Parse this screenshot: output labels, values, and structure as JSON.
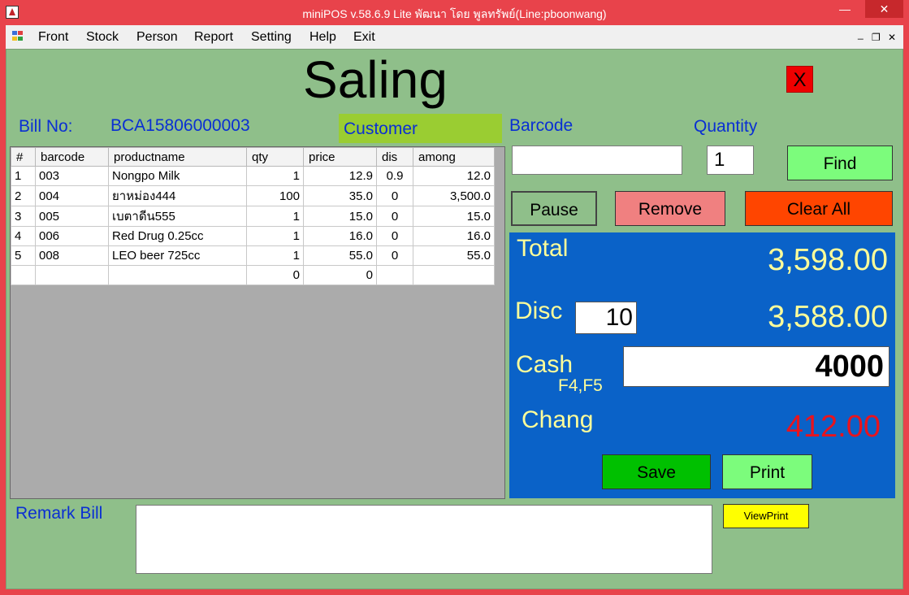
{
  "window": {
    "title": "miniPOS v.58.6.9 Lite  พัฒนา โดย พูลทรัพย์(Line:pboonwang)",
    "min_glyph": "—",
    "max_glyph": "❐",
    "close_glyph": "✕"
  },
  "menu": {
    "items": [
      "Front",
      "Stock",
      "Person",
      "Report",
      "Setting",
      "Help",
      "Exit"
    ],
    "mdi_min": "_",
    "mdi_restore": "❐",
    "mdi_close": "✕"
  },
  "form": {
    "title": "Saling",
    "close_label": "X",
    "bill_label": "Bill No:",
    "bill_value": "BCA15806000003",
    "customer_label": "Customer",
    "barcode_label": "Barcode",
    "quantity_label": "Quantity",
    "quantity_value": "1",
    "barcode_value": "",
    "remark_label": "Remark Bill",
    "remark_value": ""
  },
  "grid": {
    "columns": [
      "#",
      "barcode",
      "productname",
      "qty",
      "price",
      "dis",
      "among"
    ],
    "rows": [
      [
        "1",
        "003",
        "Nongpo Milk",
        "1",
        "12.9",
        "0.9",
        "12.0"
      ],
      [
        "2",
        "004",
        "ยาหม่อง444",
        "100",
        "35.0",
        "0",
        "3,500.0"
      ],
      [
        "3",
        "005",
        "เบตาดีน555",
        "1",
        "15.0",
        "0",
        "15.0"
      ],
      [
        "4",
        "006",
        "Red Drug 0.25cc",
        "1",
        "16.0",
        "0",
        "16.0"
      ],
      [
        "5",
        "008",
        "LEO beer 725cc",
        "1",
        "55.0",
        "0",
        "55.0"
      ],
      [
        "",
        "",
        "",
        "0",
        "0",
        "",
        ""
      ]
    ]
  },
  "buttons": {
    "find": "Find",
    "pause": "Pause",
    "remove": "Remove",
    "clear_all": "Clear All",
    "save": "Save",
    "print": "Print",
    "view_print": "ViewPrint"
  },
  "totals": {
    "total_label": "Total",
    "total_value": "3,598.00",
    "disc_label": "Disc",
    "disc_input": "10",
    "disc_value": "3,588.00",
    "cash_label": "Cash",
    "cash_hint": "F4,F5",
    "cash_value": "4000",
    "change_label": "Chang",
    "change_value": "412.00"
  },
  "colors": {
    "titlebar": "#e8434b",
    "form_bg": "#8fbf8a",
    "label_blue": "#0a2fd3",
    "panel_blue": "#0a62c8",
    "panel_text": "#fdfd9a",
    "change_red": "#e8141e"
  }
}
